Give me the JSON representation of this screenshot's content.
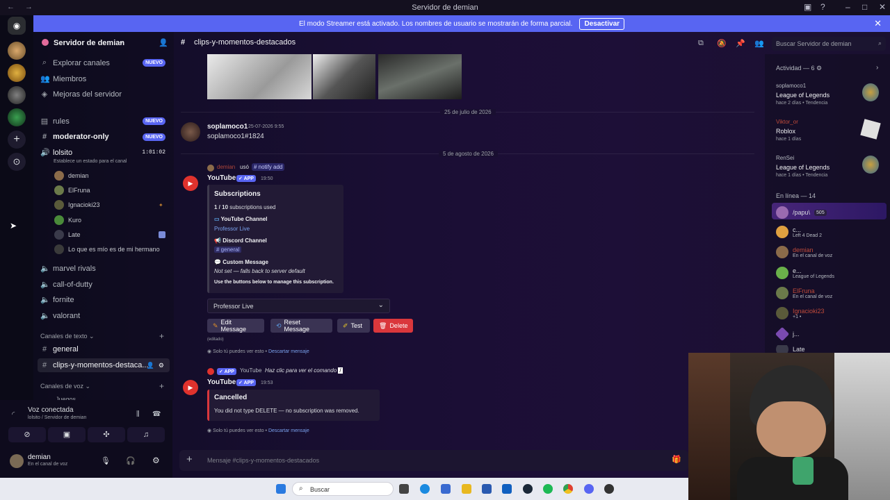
{
  "window": {
    "title": "Servidor de demian"
  },
  "banner": {
    "text": "El modo Streamer está activado. Los nombres de usuario se mostrarán de forma parcial.",
    "button": "Desactivar"
  },
  "server": {
    "name": "Servidor de demian"
  },
  "sidebar": {
    "top": [
      {
        "label": "Explorar canales",
        "badge": "NUEVO"
      },
      {
        "label": "Miembros"
      },
      {
        "label": "Mejoras del servidor"
      }
    ],
    "channels": [
      {
        "label": "rules",
        "badge": "NUEVO"
      },
      {
        "label": "moderator-only",
        "badge": "NUEVO"
      }
    ],
    "voice_channel": {
      "name": "lolsito",
      "time": "1:01:02",
      "status": "Establece un estado para el canal"
    },
    "voice_users": [
      "demian",
      "ElFruna",
      "Ignacioki23",
      "Kuro",
      "Late",
      "Lo que es mío es de mi hermano"
    ],
    "voice_channels": [
      "marvel rivals",
      "call-of-dutty",
      "fornite",
      "valorant"
    ],
    "text_category": "Canales de texto",
    "text_channels": [
      "general",
      "clips-y-momentos-destaca..."
    ],
    "voice_category": "Canales de voz",
    "cut_channel": "Juegos"
  },
  "voice_panel": {
    "title": "Voz conectada",
    "sub": "lolsito / Servidor de demian",
    "user": "demian",
    "user_status": "En el canal de voz"
  },
  "channel": {
    "name": "clips-y-momentos-destacados",
    "search_placeholder": "Buscar Servidor de demian"
  },
  "messages": {
    "date1": "25 de julio de 2026",
    "m1_author": "soplamoco1",
    "m1_time": "25-07-2026 9:55",
    "m1_text": "soplamoco1#1824",
    "date2": "5 de agosto de 2026",
    "m2_ref_user": "demian",
    "m2_ref_action": "usó",
    "m2_ref_cmd": "# notify add",
    "m2_author": "YouTube",
    "app": "APP",
    "m2_time": "19:50",
    "embed": {
      "title": "Subscriptions",
      "count_bold": "1 / 10",
      "count_rest": "subscriptions used",
      "yt_title": "YouTube Channel",
      "yt_value": "Professor Live",
      "dc_title": "Discord Channel",
      "dc_value": "# general",
      "cm_title": "Custom Message",
      "cm_value": "Not set — falls back to server default",
      "footer": "Use the buttons below to manage this subscription."
    },
    "select_value": "Professor Live",
    "buttons": {
      "edit": "Edit Message",
      "reset": "Reset Message",
      "test": "Test",
      "delete": "Delete"
    },
    "edited": "(editado)",
    "only_you": "Solo tú puedes ver esto •",
    "dismiss": "Descartar mensaje",
    "m3_ref": "YouTube",
    "m3_ref_action": "Haz clic para ver el comando",
    "m3_author": "YouTube",
    "m3_time": "19:53",
    "embed2_title": "Cancelled",
    "embed2_text": "You did not type DELETE — no subscription was removed."
  },
  "input_placeholder": "Mensaje #clips-y-momentos-destacados",
  "activity": {
    "title": "Actividad — 6",
    "items": [
      {
        "user": "soplamoco1",
        "game": "League of Legends",
        "meta": "hace 2 días  •  Tendencia"
      },
      {
        "user": "Viktor_or",
        "game": "Roblox",
        "meta": "hace 1 días"
      },
      {
        "user": "RenSei",
        "game": "League of Legends",
        "meta": "hace 1 días  •  Tendencia"
      }
    ],
    "online_title": "En línea — 14",
    "online": [
      {
        "name": "/papu\\",
        "sub": "505"
      },
      {
        "name": "c...",
        "sub": "Left 4 Dead 2"
      },
      {
        "name": "demian",
        "sub": "En el canal de voz"
      },
      {
        "name": "e...",
        "sub": "League of Legends"
      },
      {
        "name": "ElFruna",
        "sub": "En el canal de voz"
      },
      {
        "name": "Ignacioki23",
        "sub": "+1 •"
      },
      {
        "name": "j...",
        "sub": ""
      },
      {
        "name": "Late",
        "sub": ""
      }
    ]
  },
  "taskbar": {
    "search": "Buscar"
  }
}
